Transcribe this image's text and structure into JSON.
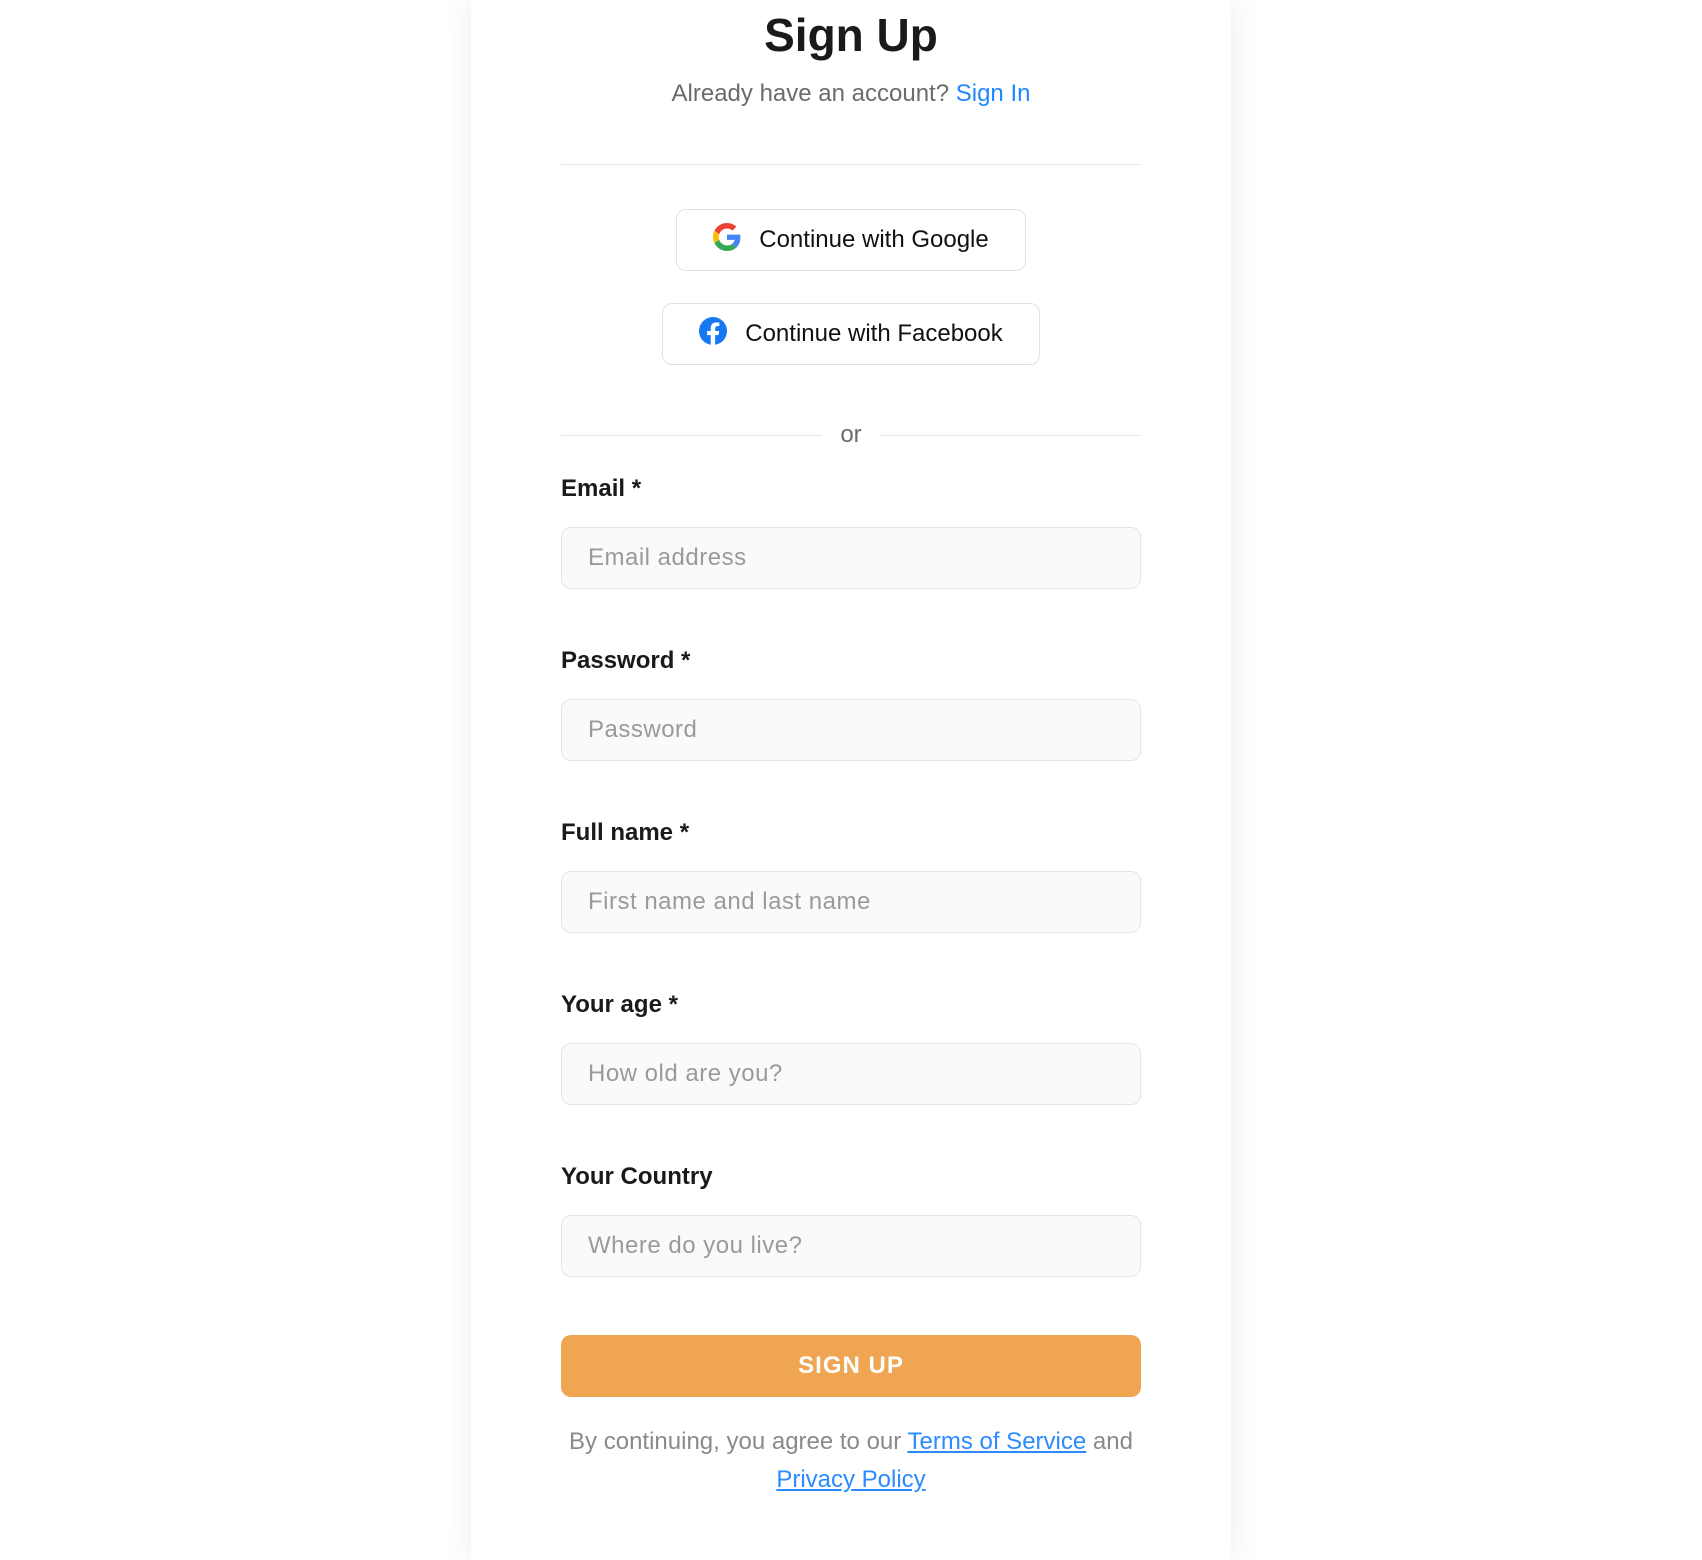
{
  "header": {
    "title": "Sign Up",
    "already_text": "Already have an account? ",
    "signin_text": "Sign In"
  },
  "social": {
    "google_label": "Continue with Google",
    "facebook_label": "Continue with Facebook",
    "divider_text": "or"
  },
  "fields": {
    "email": {
      "label": "Email *",
      "placeholder": "Email address"
    },
    "password": {
      "label": "Password *",
      "placeholder": "Password"
    },
    "fullname": {
      "label": "Full name *",
      "placeholder": "First name and last name"
    },
    "age": {
      "label": "Your age *",
      "placeholder": "How old are you?"
    },
    "country": {
      "label": "Your Country",
      "placeholder": "Where do you live?"
    }
  },
  "submit_label": "SIGN UP",
  "legal": {
    "prefix": "By continuing, you agree to our ",
    "tos": "Terms of Service",
    "and": " and ",
    "privacy": "Privacy Policy"
  }
}
